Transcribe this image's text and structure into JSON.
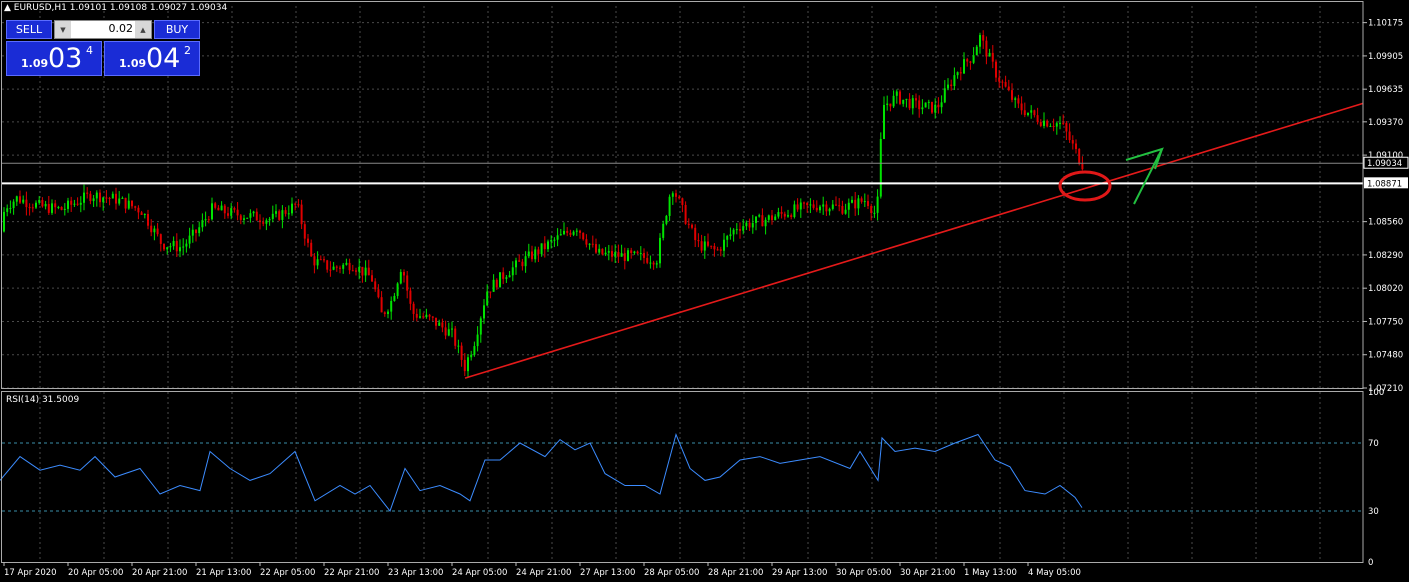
{
  "header": {
    "text": "▲ EURUSD,H1  1.09101 1.09108 1.09027 1.09034"
  },
  "trade_panel": {
    "sell_label": "SELL",
    "buy_label": "BUY",
    "lot_value": "0.02",
    "sell_price": {
      "small": "1.09",
      "big": "03",
      "sup": "4"
    },
    "buy_price": {
      "small": "1.09",
      "big": "04",
      "sup": "2"
    }
  },
  "price_axis": {
    "labels": [
      "1.10175",
      "1.09905",
      "1.09635",
      "1.09370",
      "1.09100",
      "1.08560",
      "1.08290",
      "1.08020",
      "1.07750",
      "1.07480",
      "1.07210"
    ],
    "current_price": "1.09034",
    "level_price": "1.08871"
  },
  "rsi": {
    "label": "RSI(14) 31.5009",
    "axis_labels": [
      "100",
      "70",
      "30",
      "0"
    ]
  },
  "time_axis": {
    "labels": [
      "17 Apr 2020",
      "20 Apr 05:00",
      "20 Apr 21:00",
      "21 Apr 13:00",
      "22 Apr 05:00",
      "22 Apr 21:00",
      "23 Apr 13:00",
      "24 Apr 05:00",
      "24 Apr 21:00",
      "27 Apr 13:00",
      "28 Apr 05:00",
      "28 Apr 21:00",
      "29 Apr 13:00",
      "30 Apr 05:00",
      "30 Apr 21:00",
      "1 May 13:00",
      "4 May 05:00"
    ]
  },
  "colors": {
    "bull": "#00e400",
    "bear": "#e00000",
    "grid": "#4a4a4a",
    "trendline": "#e41a1a",
    "rsi_line": "#3c8cff",
    "panel_blue": "#1a2cd6",
    "annotation_green": "#22c040"
  },
  "chart_data": {
    "type": "candlestick",
    "symbol": "EURUSD",
    "timeframe": "H1",
    "ylim": [
      1.0721,
      1.1031
    ],
    "path": [
      [
        0,
        1.0828
      ],
      [
        8,
        1.0868
      ],
      [
        20,
        1.0875
      ],
      [
        45,
        1.0868
      ],
      [
        65,
        1.0866
      ],
      [
        95,
        1.0878
      ],
      [
        120,
        1.0874
      ],
      [
        145,
        1.0865
      ],
      [
        165,
        1.0838
      ],
      [
        185,
        1.0835
      ],
      [
        200,
        1.0848
      ],
      [
        215,
        1.0866
      ],
      [
        240,
        1.0862
      ],
      [
        275,
        1.0858
      ],
      [
        300,
        1.087
      ],
      [
        315,
        1.0825
      ],
      [
        335,
        1.0818
      ],
      [
        355,
        1.0822
      ],
      [
        375,
        1.081
      ],
      [
        385,
        1.078
      ],
      [
        395,
        1.0792
      ],
      [
        405,
        1.0822
      ],
      [
        415,
        1.0782
      ],
      [
        435,
        1.0776
      ],
      [
        455,
        1.0765
      ],
      [
        468,
        1.0738
      ],
      [
        478,
        1.076
      ],
      [
        490,
        1.08
      ],
      [
        510,
        1.0815
      ],
      [
        530,
        1.0826
      ],
      [
        560,
        1.0842
      ],
      [
        580,
        1.0852
      ],
      [
        600,
        1.083
      ],
      [
        630,
        1.0828
      ],
      [
        660,
        1.0826
      ],
      [
        675,
        1.0886
      ],
      [
        688,
        1.086
      ],
      [
        700,
        1.0838
      ],
      [
        720,
        1.0832
      ],
      [
        740,
        1.0852
      ],
      [
        770,
        1.0858
      ],
      [
        800,
        1.0866
      ],
      [
        825,
        1.087
      ],
      [
        845,
        1.0867
      ],
      [
        870,
        1.0874
      ],
      [
        880,
        1.086
      ],
      [
        886,
        1.095
      ],
      [
        900,
        1.0957
      ],
      [
        920,
        1.095
      ],
      [
        940,
        1.0948
      ],
      [
        960,
        1.0978
      ],
      [
        975,
        1.099
      ],
      [
        983,
        1.1006
      ],
      [
        1000,
        1.0975
      ],
      [
        1020,
        1.095
      ],
      [
        1045,
        1.0938
      ],
      [
        1065,
        1.0935
      ],
      [
        1085,
        1.0903
      ]
    ],
    "rsi": [
      [
        0,
        48
      ],
      [
        20,
        62
      ],
      [
        40,
        54
      ],
      [
        60,
        57
      ],
      [
        80,
        54
      ],
      [
        95,
        62
      ],
      [
        115,
        50
      ],
      [
        140,
        55
      ],
      [
        160,
        40
      ],
      [
        180,
        45
      ],
      [
        200,
        42
      ],
      [
        210,
        65
      ],
      [
        230,
        55
      ],
      [
        250,
        48
      ],
      [
        270,
        52
      ],
      [
        295,
        65
      ],
      [
        315,
        36
      ],
      [
        340,
        45
      ],
      [
        355,
        40
      ],
      [
        370,
        45
      ],
      [
        390,
        30
      ],
      [
        405,
        55
      ],
      [
        420,
        42
      ],
      [
        440,
        45
      ],
      [
        460,
        40
      ],
      [
        470,
        36
      ],
      [
        485,
        60
      ],
      [
        500,
        60
      ],
      [
        520,
        70
      ],
      [
        545,
        62
      ],
      [
        560,
        72
      ],
      [
        575,
        66
      ],
      [
        590,
        70
      ],
      [
        605,
        52
      ],
      [
        625,
        45
      ],
      [
        645,
        45
      ],
      [
        660,
        40
      ],
      [
        676,
        75
      ],
      [
        690,
        55
      ],
      [
        705,
        48
      ],
      [
        720,
        50
      ],
      [
        740,
        60
      ],
      [
        760,
        62
      ],
      [
        780,
        58
      ],
      [
        800,
        60
      ],
      [
        820,
        62
      ],
      [
        850,
        55
      ],
      [
        860,
        65
      ],
      [
        878,
        48
      ],
      [
        882,
        73
      ],
      [
        895,
        65
      ],
      [
        915,
        67
      ],
      [
        935,
        65
      ],
      [
        955,
        70
      ],
      [
        978,
        75
      ],
      [
        995,
        60
      ],
      [
        1010,
        56
      ],
      [
        1025,
        42
      ],
      [
        1045,
        40
      ],
      [
        1060,
        45
      ],
      [
        1075,
        38
      ],
      [
        1082,
        32
      ]
    ],
    "trendline": {
      "from": [
        465,
        1.0729
      ],
      "to": [
        1363,
        1.0952
      ]
    },
    "level_line": 1.08871,
    "current_price": 1.09034
  }
}
